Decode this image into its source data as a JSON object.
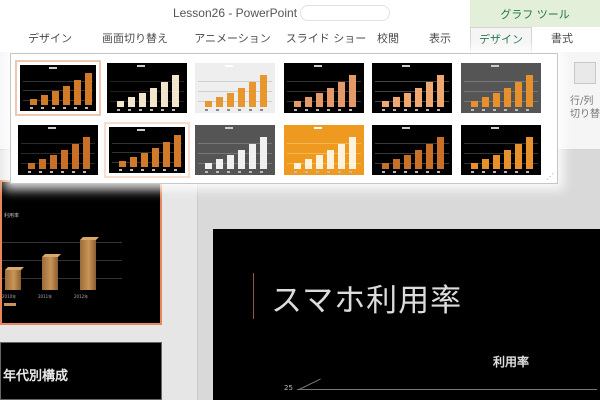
{
  "window": {
    "title": "Lesson26 - PowerPoint"
  },
  "context_tab": {
    "label": "グラフ ツール"
  },
  "tabs": [
    {
      "label": "デザイン",
      "active": false
    },
    {
      "label": "画面切り替え",
      "active": false
    },
    {
      "label": "アニメーション",
      "active": false
    },
    {
      "label": "スライド ショー",
      "active": false
    },
    {
      "label": "校閲",
      "active": false
    },
    {
      "label": "表示",
      "active": false
    },
    {
      "label": "デザイン",
      "active": true
    },
    {
      "label": "書式",
      "active": false
    }
  ],
  "ribbon": {
    "switch_row_col": {
      "line1": "行/列",
      "line2": "切り替"
    }
  },
  "chart_style_gallery": {
    "styles": [
      {
        "bg": "#000000",
        "bar": "#d07a2a",
        "grid": "#333333",
        "selected": true
      },
      {
        "bg": "#000000",
        "bar": "#f1e6cc",
        "grid": "#222222"
      },
      {
        "bg": "#eeeeee",
        "bar": "#e8962e",
        "grid": "#cfcfcf"
      },
      {
        "bg": "#000000",
        "bar": "#e49a68",
        "grid": "#333333"
      },
      {
        "bg": "#000000",
        "bar": "#f0a870",
        "grid": "#444444"
      },
      {
        "bg": "#555555",
        "bar": "#e8902c",
        "grid": "#777777"
      },
      {
        "bg": "#000000",
        "bar": "#c87028",
        "grid": "#2a2a2a"
      },
      {
        "bg": "#000000",
        "bar": "#d07a2a",
        "grid": "#333333",
        "hovered": true
      },
      {
        "bg": "#555555",
        "bar": "#f0f0f0",
        "grid": "#777777"
      },
      {
        "bg": "#ee9a20",
        "bar": "#fff3de",
        "grid": "#f5b650"
      },
      {
        "bg": "#000000",
        "bar": "#c87028",
        "grid": "#3a3a3a"
      },
      {
        "bg": "#000000",
        "bar": "#e8902c",
        "grid": "#333333"
      }
    ]
  },
  "thumbnails": {
    "slide1": {
      "chart_title": "利用率",
      "x_labels": [
        "2010年",
        "2011年",
        "2012年"
      ]
    },
    "slide2": {
      "title": "年代別構成"
    }
  },
  "main_slide": {
    "title": "スマホ利用率",
    "chart_title": "利用率",
    "y_tick": "25"
  },
  "colors": {
    "accent_green": "#217346",
    "selection_border": "#e6865a",
    "bar_brown": "#c99558"
  }
}
